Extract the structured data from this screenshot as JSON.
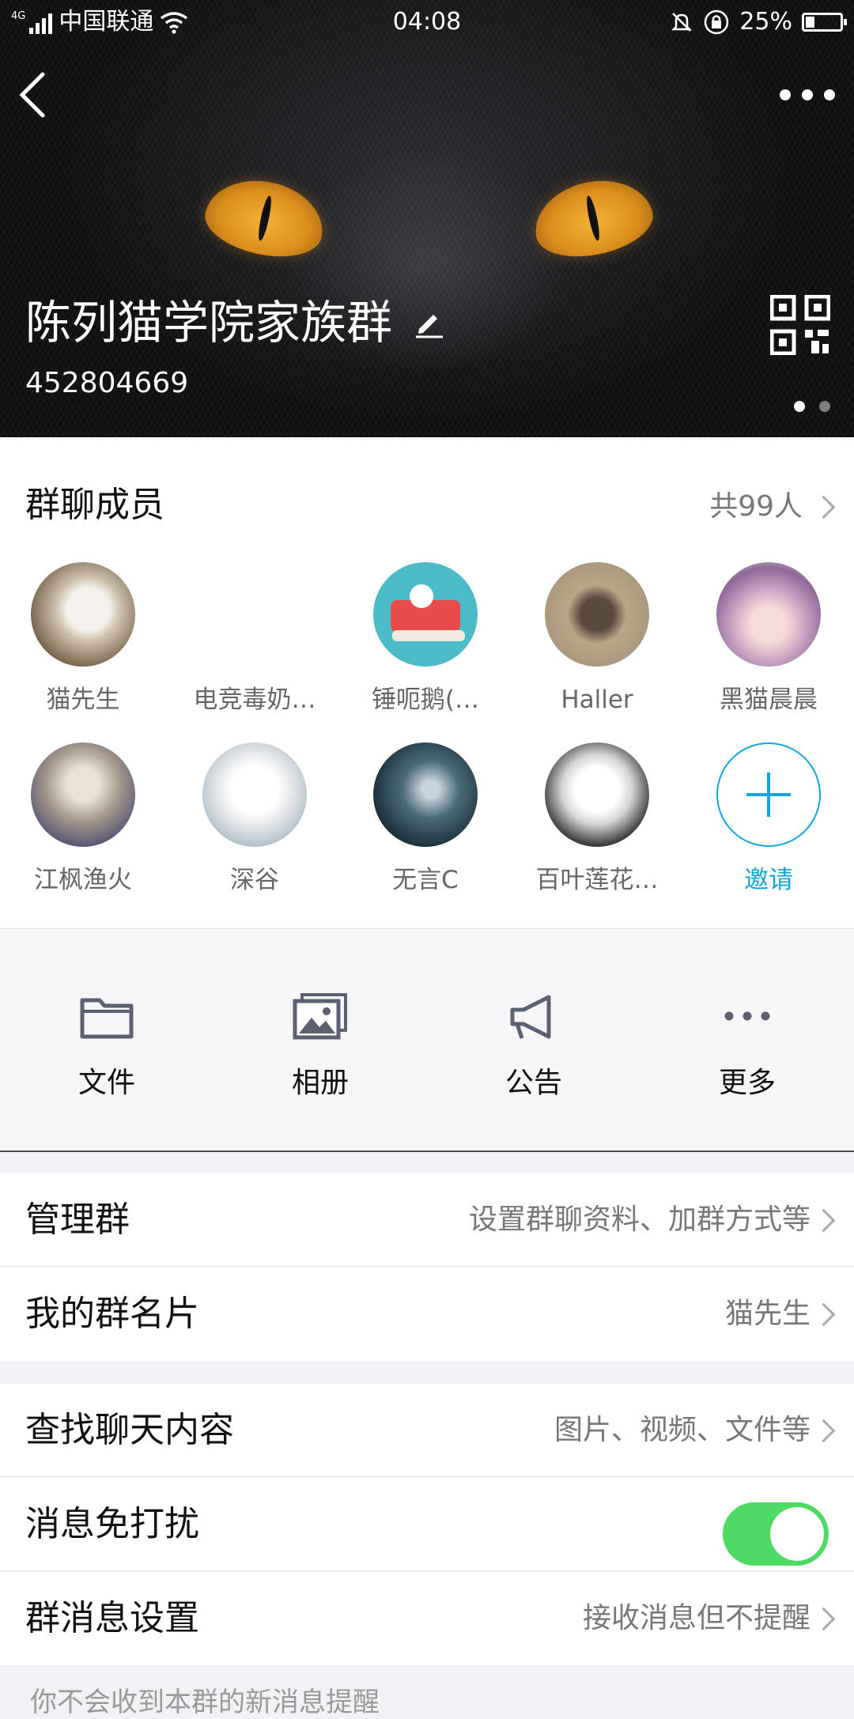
{
  "status_bar": {
    "network_badge": "4G",
    "carrier": "中国联通",
    "time": "04:08",
    "battery_percent": "25%",
    "battery_level": 0.25
  },
  "header": {
    "group_name": "陈列猫学院家族群",
    "group_id": "452804669",
    "cover_pages": 2,
    "active_page": 0
  },
  "members": {
    "title": "群聊成员",
    "count_label": "共99人",
    "list": [
      {
        "name": "猫先生",
        "avatar": "cat-photo"
      },
      {
        "name": "电竞毒奶…",
        "avatar": "none"
      },
      {
        "name": "锤呃鹅(…",
        "avatar": "cartoon-couch"
      },
      {
        "name": "Haller",
        "avatar": "sketch-portrait"
      },
      {
        "name": "黑猫晨晨",
        "avatar": "anime-girl"
      },
      {
        "name": "江枫渔火",
        "avatar": "anime-boy"
      },
      {
        "name": "深谷",
        "avatar": "white-anime"
      },
      {
        "name": "无言C",
        "avatar": "night-scene"
      },
      {
        "name": "百叶莲花…",
        "avatar": "white-hair-anime"
      }
    ],
    "invite_label": "邀请"
  },
  "tools": [
    {
      "label": "文件",
      "icon": "folder-icon"
    },
    {
      "label": "相册",
      "icon": "album-icon"
    },
    {
      "label": "公告",
      "icon": "megaphone-icon"
    },
    {
      "label": "更多",
      "icon": "more-icon"
    }
  ],
  "settings": {
    "manage_label": "管理群",
    "manage_value": "设置群聊资料、加群方式等",
    "card_label": "我的群名片",
    "card_value": "猫先生",
    "search_label": "查找聊天内容",
    "search_value": "图片、视频、文件等",
    "dnd_label": "消息免打扰",
    "dnd_on": true,
    "msg_label": "群消息设置",
    "msg_value": "接收消息但不提醒",
    "footnote": "你不会收到本群的新消息提醒"
  },
  "colors": {
    "accent": "#12a5e0",
    "toggle_on": "#4cd964"
  }
}
